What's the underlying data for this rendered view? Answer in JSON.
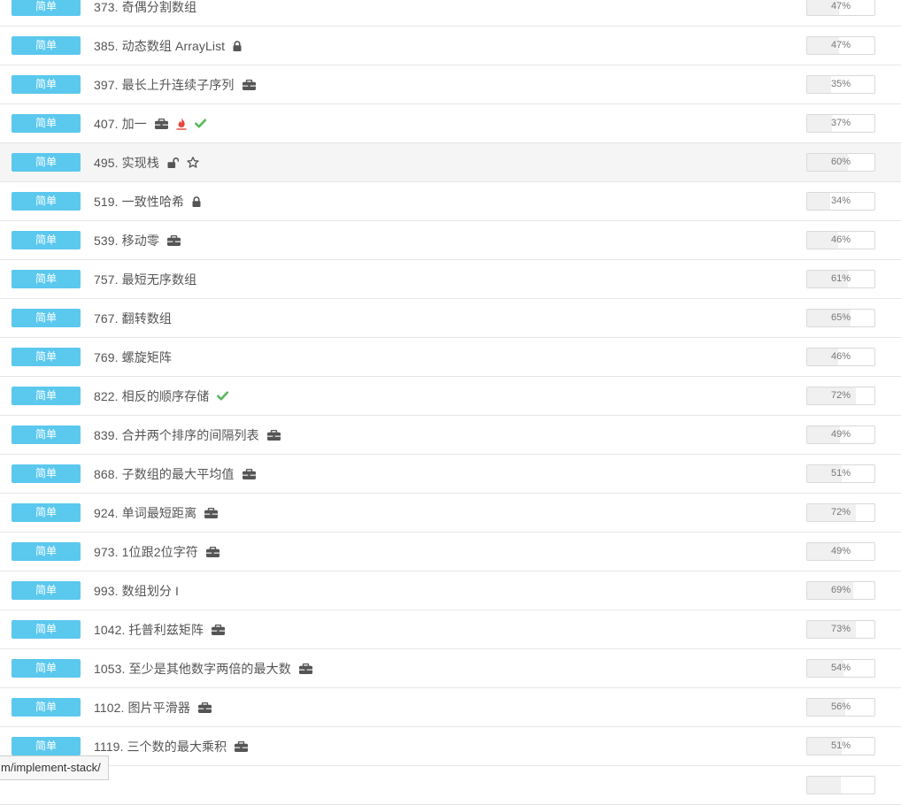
{
  "problems": [
    {
      "difficulty": "简单",
      "title": "373. 奇偶分割数组",
      "icons": [],
      "acceptance": "47%",
      "acceptance_value": 0.47
    },
    {
      "difficulty": "简单",
      "title": "385. 动态数组 ArrayList",
      "icons": [
        "lock-icon"
      ],
      "acceptance": "47%",
      "acceptance_value": 0.47
    },
    {
      "difficulty": "简单",
      "title": "397. 最长上升连续子序列",
      "icons": [
        "briefcase-icon"
      ],
      "acceptance": "35%",
      "acceptance_value": 0.35
    },
    {
      "difficulty": "简单",
      "title": "407. 加一",
      "icons": [
        "briefcase-icon",
        "flame-icon",
        "check-icon"
      ],
      "acceptance": "37%",
      "acceptance_value": 0.37
    },
    {
      "difficulty": "简单",
      "title": "495. 实现栈",
      "icons": [
        "unlock-icon",
        "star-icon"
      ],
      "acceptance": "60%",
      "acceptance_value": 0.6
    },
    {
      "difficulty": "简单",
      "title": "519. 一致性哈希",
      "icons": [
        "lock-icon"
      ],
      "acceptance": "34%",
      "acceptance_value": 0.34
    },
    {
      "difficulty": "简单",
      "title": "539. 移动零",
      "icons": [
        "briefcase-icon"
      ],
      "acceptance": "46%",
      "acceptance_value": 0.46
    },
    {
      "difficulty": "简单",
      "title": "757. 最短无序数组",
      "icons": [],
      "acceptance": "61%",
      "acceptance_value": 0.61
    },
    {
      "difficulty": "简单",
      "title": "767. 翻转数组",
      "icons": [],
      "acceptance": "65%",
      "acceptance_value": 0.65
    },
    {
      "difficulty": "简单",
      "title": "769. 螺旋矩阵",
      "icons": [],
      "acceptance": "46%",
      "acceptance_value": 0.46
    },
    {
      "difficulty": "简单",
      "title": "822. 相反的顺序存储",
      "icons": [
        "check-icon"
      ],
      "acceptance": "72%",
      "acceptance_value": 0.72
    },
    {
      "difficulty": "简单",
      "title": "839. 合并两个排序的间隔列表",
      "icons": [
        "briefcase-icon"
      ],
      "acceptance": "49%",
      "acceptance_value": 0.49
    },
    {
      "difficulty": "简单",
      "title": "868. 子数组的最大平均值",
      "icons": [
        "briefcase-icon"
      ],
      "acceptance": "51%",
      "acceptance_value": 0.51
    },
    {
      "difficulty": "简单",
      "title": "924. 单词最短距离",
      "icons": [
        "briefcase-icon"
      ],
      "acceptance": "72%",
      "acceptance_value": 0.72
    },
    {
      "difficulty": "简单",
      "title": "973. 1位跟2位字符",
      "icons": [
        "briefcase-icon"
      ],
      "acceptance": "49%",
      "acceptance_value": 0.49
    },
    {
      "difficulty": "简单",
      "title": "993. 数组划分 I",
      "icons": [],
      "acceptance": "69%",
      "acceptance_value": 0.69
    },
    {
      "difficulty": "简单",
      "title": "1042. 托普利兹矩阵",
      "icons": [
        "briefcase-icon"
      ],
      "acceptance": "73%",
      "acceptance_value": 0.73
    },
    {
      "difficulty": "简单",
      "title": "1053. 至少是其他数字两倍的最大数",
      "icons": [
        "briefcase-icon"
      ],
      "acceptance": "54%",
      "acceptance_value": 0.54
    },
    {
      "difficulty": "简单",
      "title": "1102. 图片平滑器",
      "icons": [
        "briefcase-icon"
      ],
      "acceptance": "56%",
      "acceptance_value": 0.56
    },
    {
      "difficulty": "简单",
      "title": "1119. 三个数的最大乘积",
      "icons": [
        "briefcase-icon"
      ],
      "acceptance": "51%",
      "acceptance_value": 0.51
    },
    {
      "difficulty": "",
      "title": "",
      "icons": [],
      "acceptance": "",
      "acceptance_value": 0.5
    }
  ],
  "hovered_index": 4,
  "status_bar": {
    "url": "m/implement-stack/"
  },
  "colors": {
    "badge": "#5bc8ee",
    "icon": "#555555",
    "check": "#5cb85c",
    "flame": "#e8433b",
    "progress_fill": "#f0f0f0"
  }
}
